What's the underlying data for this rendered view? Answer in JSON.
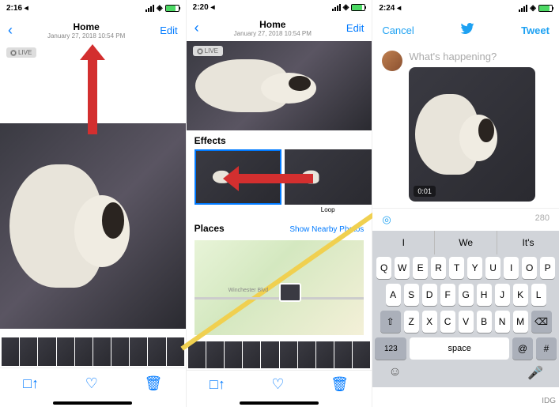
{
  "screen1": {
    "time": "2:16 ◂",
    "nav": {
      "title": "Home",
      "subtitle": "January 27, 2018  10:54 PM",
      "edit": "Edit"
    },
    "live_badge": "LIVE"
  },
  "screen2": {
    "time": "2:20 ◂",
    "nav": {
      "title": "Home",
      "subtitle": "January 27, 2018  10:54 PM",
      "edit": "Edit"
    },
    "live_badge": "LIVE",
    "effects": {
      "title": "Effects",
      "loop_label": "Loop"
    },
    "places": {
      "title": "Places",
      "nearby": "Show Nearby Photos",
      "road_label": "Winchester Blvd"
    }
  },
  "screen3": {
    "time": "2:24 ◂",
    "nav": {
      "cancel": "Cancel",
      "tweet": "Tweet"
    },
    "compose": {
      "placeholder": "What's happening?",
      "video_time": "0:01",
      "char_count": "280"
    },
    "suggestions": [
      "I",
      "We",
      "It's"
    ],
    "keyboard": {
      "row1": [
        "Q",
        "W",
        "E",
        "R",
        "T",
        "Y",
        "U",
        "I",
        "O",
        "P"
      ],
      "row2": [
        "A",
        "S",
        "D",
        "F",
        "G",
        "H",
        "J",
        "K",
        "L"
      ],
      "row3": [
        "Z",
        "X",
        "C",
        "V",
        "B",
        "N",
        "M"
      ],
      "num": "123",
      "space": "space",
      "at": "@",
      "hash": "#"
    }
  },
  "credit": "IDG"
}
